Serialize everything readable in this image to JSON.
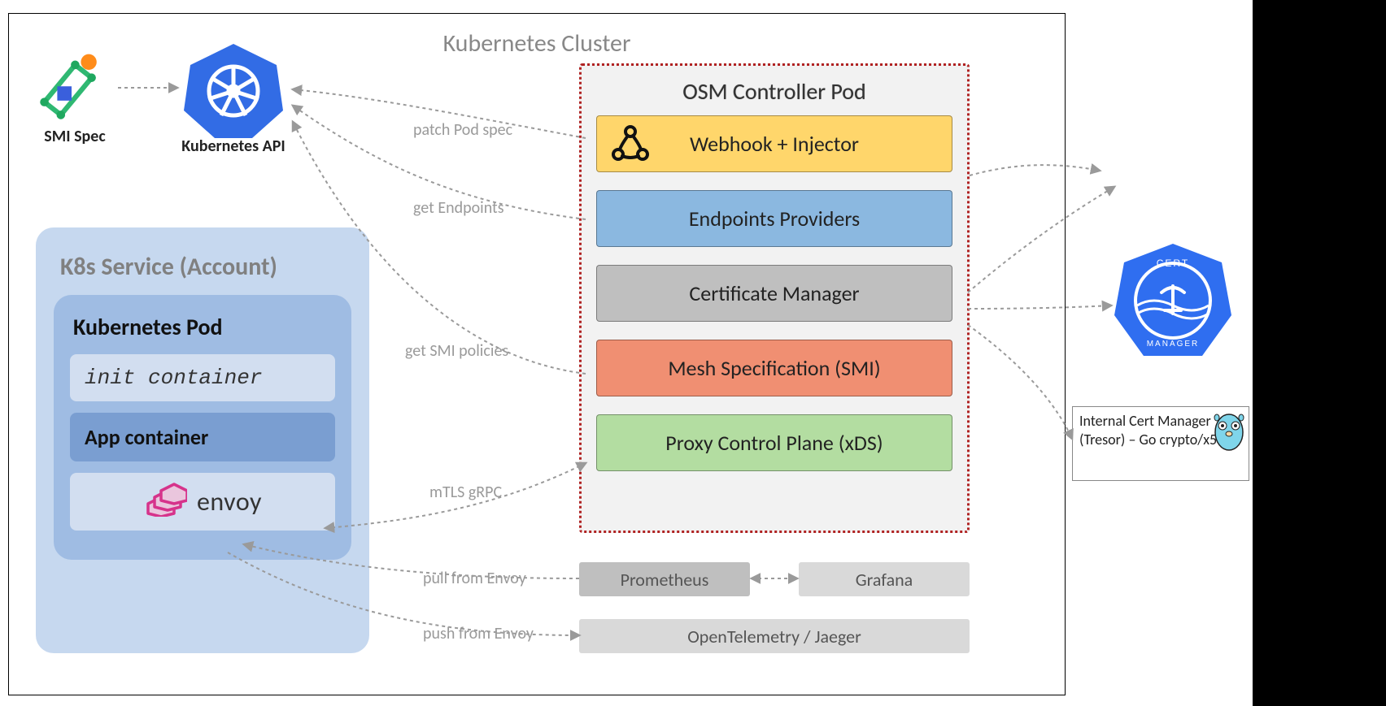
{
  "cluster": {
    "title": "Kubernetes Cluster"
  },
  "smi": {
    "label": "SMI Spec"
  },
  "k8s_api": {
    "label": "Kubernetes API"
  },
  "service_panel": {
    "title": "K8s Service (Account)",
    "pod_title": "Kubernetes Pod",
    "init_container": "init container",
    "app_container": "App container",
    "envoy": "envoy"
  },
  "osm": {
    "title": "OSM Controller Pod",
    "webhook": "Webhook + Injector",
    "endpoints": "Endpoints Providers",
    "certmgr": "Certificate Manager",
    "mesh": "Mesh Specification (SMI)",
    "proxy": "Proxy Control Plane (xDS)"
  },
  "metrics": {
    "prometheus": "Prometheus",
    "grafana": "Grafana",
    "otel": "OpenTelemetry / Jaeger"
  },
  "external": {
    "certmanager_badge": "CERT MANAGER",
    "tresor": "Internal Cert Manager (Tresor) – Go crypto/x509"
  },
  "edges": {
    "patch_pod": "patch Pod spec",
    "get_endpoints": "get Endpoints",
    "get_smi": "get SMI policies",
    "mtls": "mTLS gRPC",
    "pull_envoy": "pull from Envoy",
    "push_envoy": "push from Envoy"
  },
  "colors": {
    "k8s_blue": "#326ce5",
    "panel_blue_light": "#c6d8ef",
    "panel_blue_mid": "#9fbce3",
    "panel_blue_dark": "#7a9ed1",
    "webhook_yellow": "#ffd66b",
    "endpoints_blue": "#8bb8e0",
    "certmgr_gray": "#bfbfbf",
    "mesh_orange": "#f08f72",
    "proxy_green": "#b3dda1",
    "osm_border": "#b02222",
    "envoy_pink": "#d6338b"
  }
}
